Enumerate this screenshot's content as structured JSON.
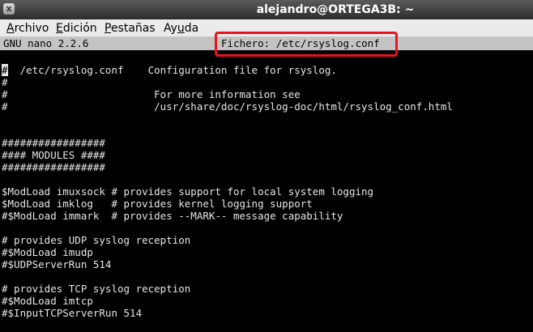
{
  "window": {
    "title": "alejandro@ORTEGA3B: ~",
    "close_glyph": "x"
  },
  "menubar": {
    "items": [
      {
        "mnemonic": "A",
        "rest": "rchivo"
      },
      {
        "mnemonic": "E",
        "rest": "dición"
      },
      {
        "mnemonic": "P",
        "rest": "estañas"
      },
      {
        "pre": "Ay",
        "mnemonic": "u",
        "rest": "da"
      }
    ]
  },
  "nano": {
    "version": "GNU nano 2.2.6",
    "file_label": "Fichero: /etc/rsyslog.conf",
    "highlight_color": "#e8141c"
  },
  "buffer": {
    "lines": [
      "#  /etc/rsyslog.conf    Configuration file for rsyslog.",
      "#",
      "#                        For more information see",
      "#                        /usr/share/doc/rsyslog-doc/html/rsyslog_conf.html",
      "",
      "",
      "#################",
      "#### MODULES ####",
      "#################",
      "",
      "$ModLoad imuxsock # provides support for local system logging",
      "$ModLoad imklog   # provides kernel logging support",
      "#$ModLoad immark  # provides --MARK-- message capability",
      "",
      "# provides UDP syslog reception",
      "#$ModLoad imudp",
      "#$UDPServerRun 514",
      "",
      "# provides TCP syslog reception",
      "#$ModLoad imtcp",
      "#$InputTCPServerRun 514"
    ]
  }
}
